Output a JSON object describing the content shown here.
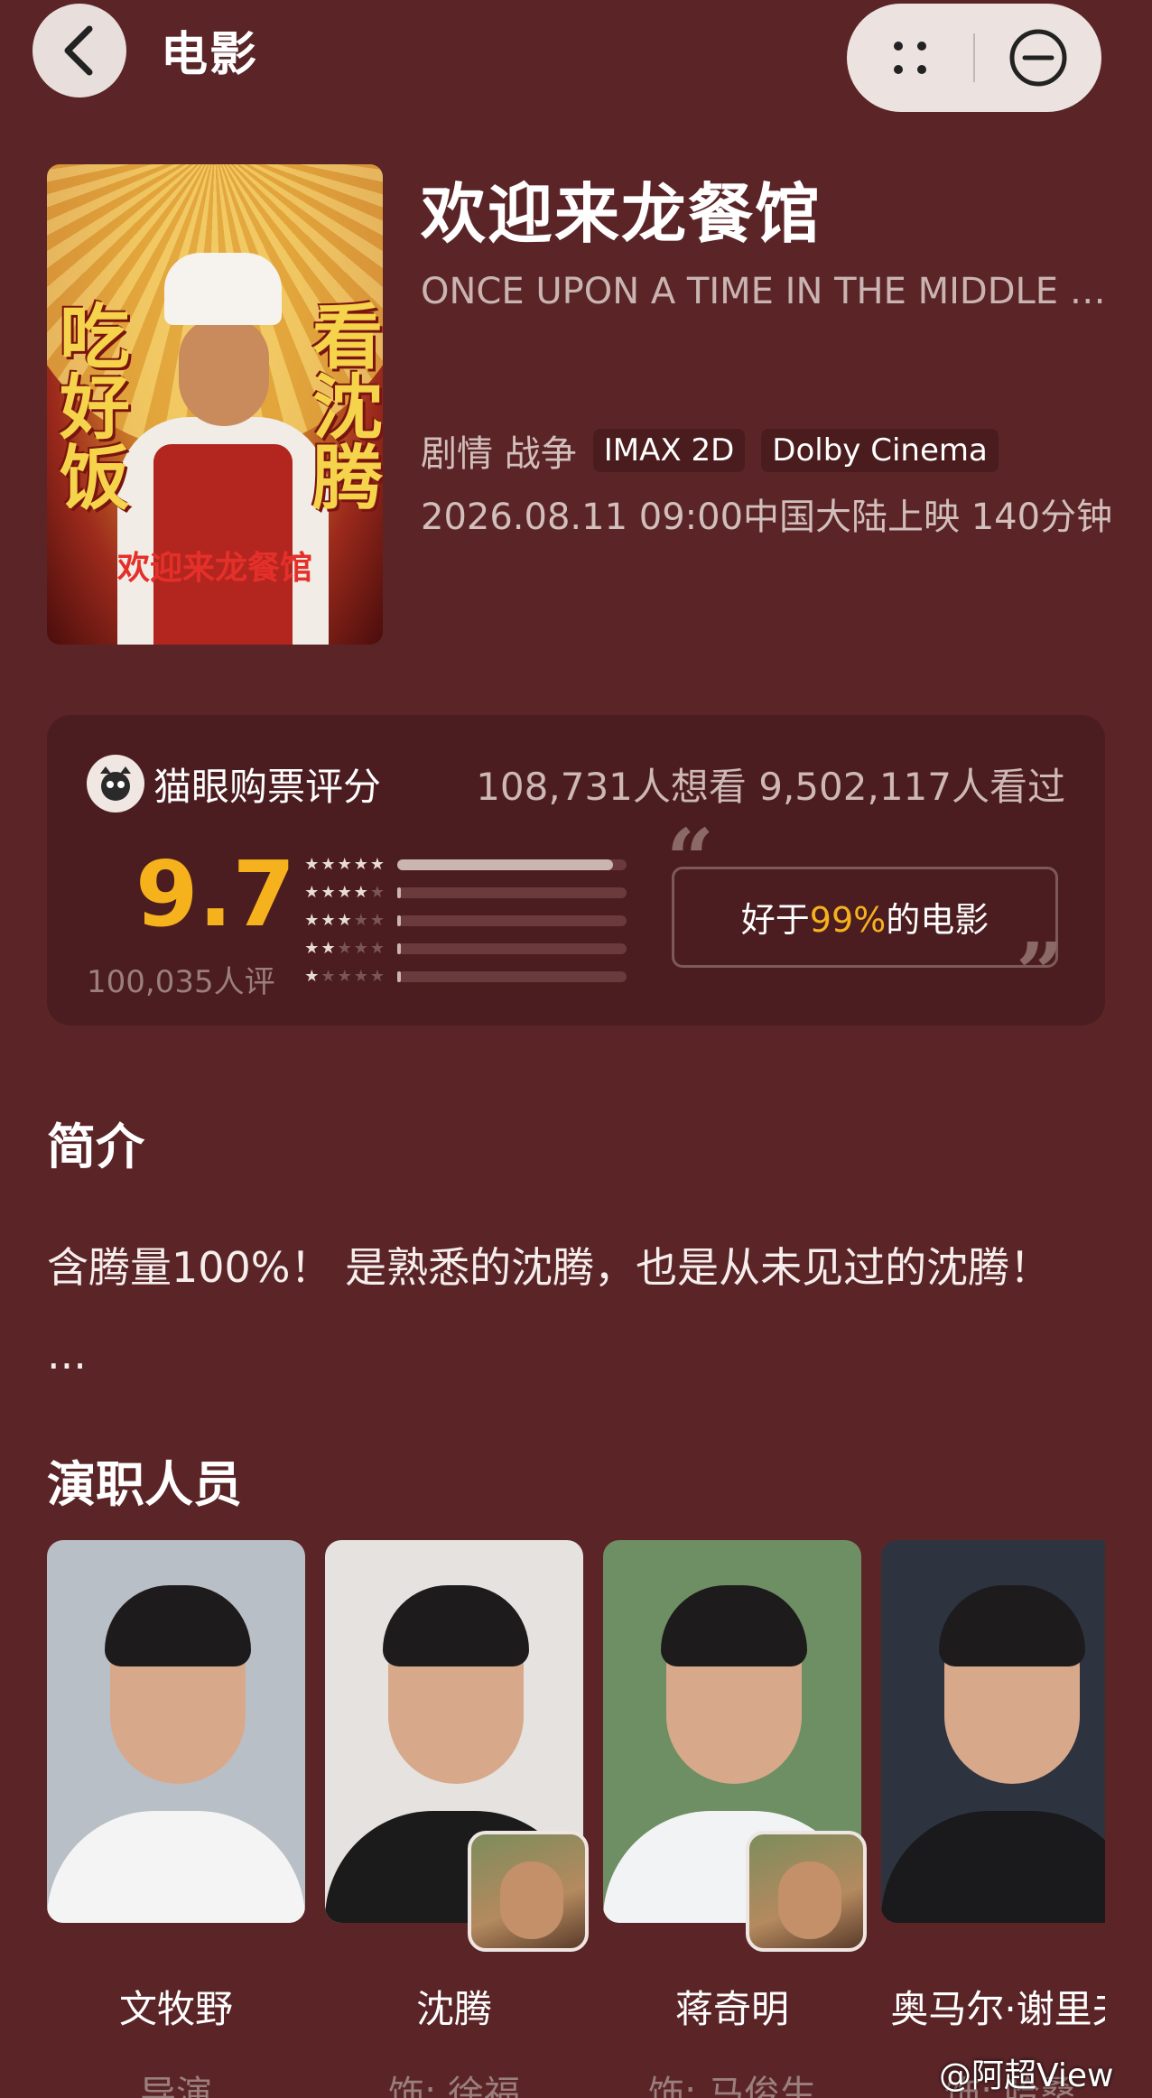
{
  "header": {
    "title": "电影"
  },
  "movie": {
    "title_cn": "欢迎来龙餐馆",
    "title_en": "ONCE UPON A TIME IN THE MIDDLE EAST",
    "genres": "剧情 战争",
    "tags": [
      "IMAX 2D",
      "Dolby Cinema"
    ],
    "release": "2026.08.11 09:00中国大陆上映 140分钟",
    "poster": {
      "side_left": "吃好饭",
      "side_right": "看沈腾",
      "logo": "欢迎来龙餐馆"
    }
  },
  "rating": {
    "label": "猫眼购票评分",
    "stats": "108,731人想看 9,502,117人看过",
    "score": "9.7",
    "raters": "100,035人评",
    "distribution": [
      {
        "stars": 5,
        "fraction": 0.94
      },
      {
        "stars": 4,
        "fraction": 0.01
      },
      {
        "stars": 3,
        "fraction": 0.01
      },
      {
        "stars": 2,
        "fraction": 0.01
      },
      {
        "stars": 1,
        "fraction": 0.01
      }
    ],
    "quote_prefix": "好于",
    "quote_highlight": "99%",
    "quote_suffix": "的电影"
  },
  "synopsis": {
    "title": "简介",
    "text": "含腾量100%！ 是熟悉的沈腾，也是从未见过的沈腾！ ..."
  },
  "cast": {
    "title": "演职人员",
    "members": [
      {
        "name": "文牧野",
        "role": "导演",
        "bg": "#b9bfc6",
        "shirt": "#f4f4f4"
      },
      {
        "name": "沈腾",
        "role": "饰: 徐福",
        "bg": "#e5e2df",
        "shirt": "#1b1b1c"
      },
      {
        "name": "蒋奇明",
        "role": "饰: 马俊生",
        "bg": "#6e8f63",
        "shirt": "#f2f3f5"
      },
      {
        "name": "奥马尔·谢里夫",
        "role": "饰: 哈桑",
        "bg": "#2e3340",
        "shirt": "#1a1a1c"
      }
    ]
  },
  "watermark": "@阿超View"
}
